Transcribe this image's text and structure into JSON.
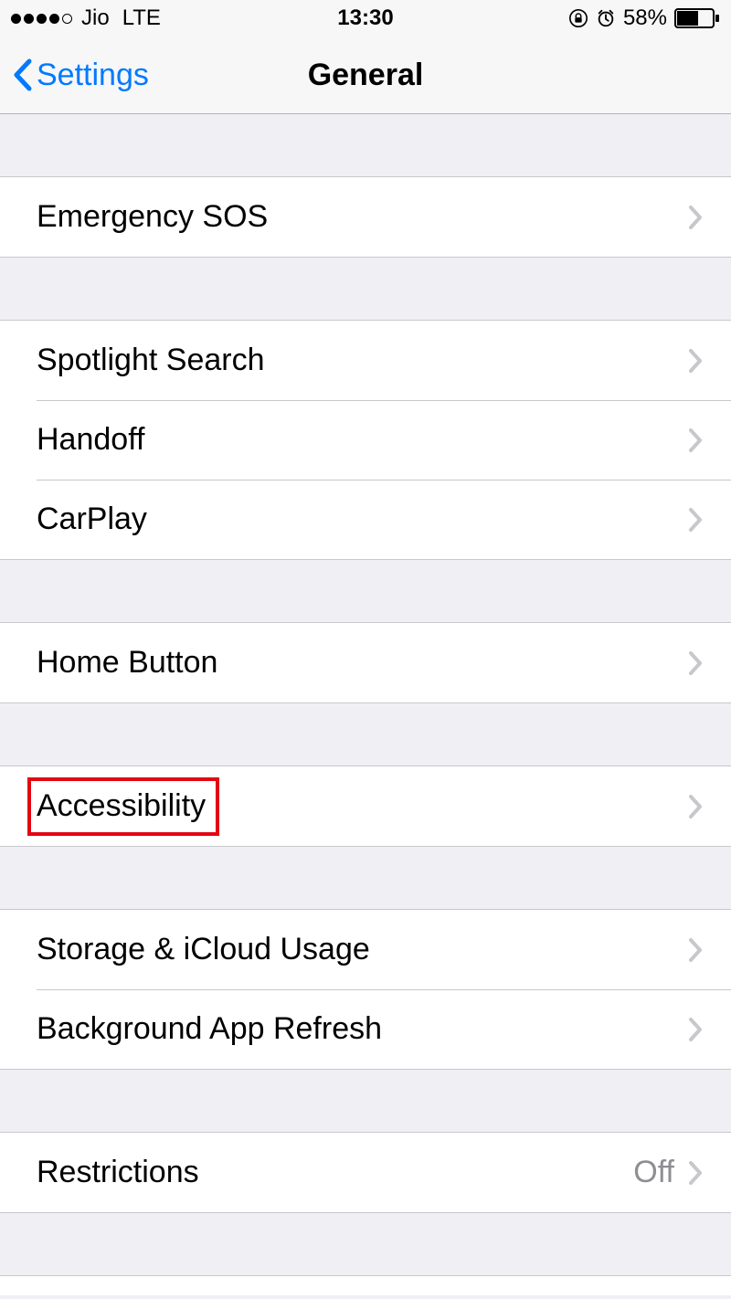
{
  "statusBar": {
    "carrier": "Jio",
    "network": "LTE",
    "time": "13:30",
    "batteryPercent": "58%"
  },
  "nav": {
    "back": "Settings",
    "title": "General"
  },
  "groups": [
    {
      "rows": [
        {
          "label": "Emergency SOS",
          "value": ""
        }
      ]
    },
    {
      "rows": [
        {
          "label": "Spotlight Search",
          "value": ""
        },
        {
          "label": "Handoff",
          "value": ""
        },
        {
          "label": "CarPlay",
          "value": ""
        }
      ]
    },
    {
      "rows": [
        {
          "label": "Home Button",
          "value": ""
        }
      ]
    },
    {
      "rows": [
        {
          "label": "Accessibility",
          "value": ""
        }
      ]
    },
    {
      "rows": [
        {
          "label": "Storage & iCloud Usage",
          "value": ""
        },
        {
          "label": "Background App Refresh",
          "value": ""
        }
      ]
    },
    {
      "rows": [
        {
          "label": "Restrictions",
          "value": "Off"
        }
      ]
    }
  ]
}
